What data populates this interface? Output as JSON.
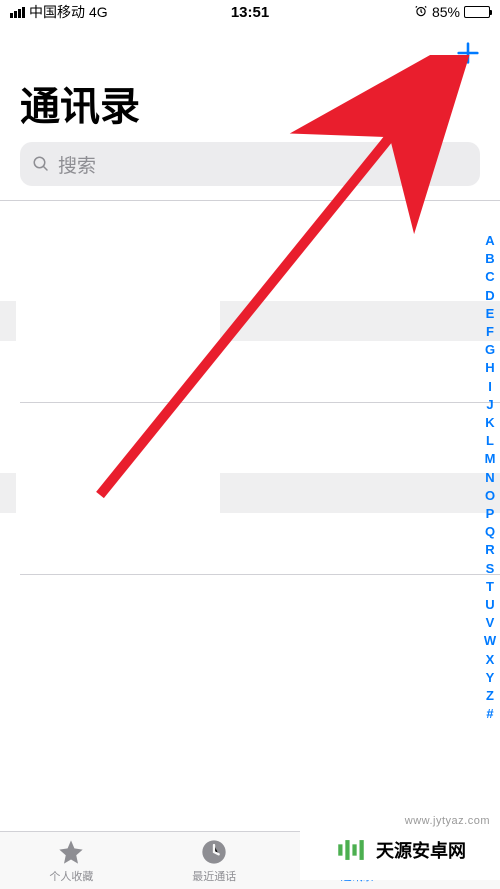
{
  "status": {
    "carrier": "中国移动",
    "network": "4G",
    "time": "13:51",
    "battery_pct": "85%"
  },
  "header": {
    "title": "通讯录"
  },
  "search": {
    "placeholder": "搜索"
  },
  "index_letters": [
    "A",
    "B",
    "C",
    "D",
    "E",
    "F",
    "G",
    "H",
    "I",
    "J",
    "K",
    "L",
    "M",
    "N",
    "O",
    "P",
    "Q",
    "R",
    "S",
    "T",
    "U",
    "V",
    "W",
    "X",
    "Y",
    "Z",
    "#"
  ],
  "tabs": {
    "favorites": "个人收藏",
    "recents": "最近通话",
    "contacts": "通讯录"
  },
  "watermark": {
    "site_name": "天源安卓网",
    "url": "www.jytyaz.com"
  },
  "colors": {
    "accent": "#007AFF",
    "inactive": "#8E8E93",
    "arrow": "#E91E2D"
  }
}
